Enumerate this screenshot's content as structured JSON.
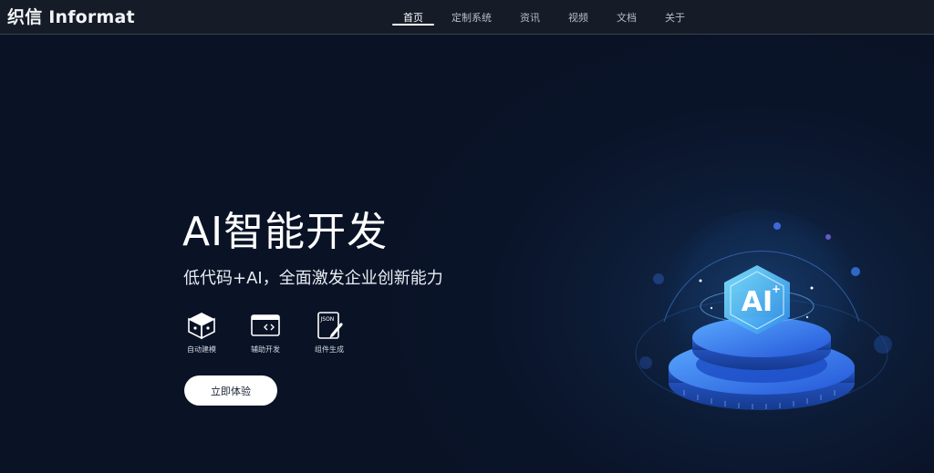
{
  "nav": {
    "logo": "织信 Informat",
    "items": [
      {
        "label": "首页",
        "active": true
      },
      {
        "label": "定制系统",
        "active": false
      },
      {
        "label": "资讯",
        "active": false
      },
      {
        "label": "视频",
        "active": false
      },
      {
        "label": "文档",
        "active": false
      },
      {
        "label": "关于",
        "active": false
      }
    ]
  },
  "hero": {
    "title": "AI智能开发",
    "subtitle": "低代码+AI，全面激发企业创新能力",
    "features": [
      {
        "label": "自动建模",
        "icon": "cube-icon"
      },
      {
        "label": "辅助开发",
        "icon": "code-window-icon"
      },
      {
        "label": "组件生成",
        "icon": "json-document-icon"
      }
    ],
    "cta_label": "立即体验",
    "illustration": {
      "badge_text": "AI",
      "accent": "#3a7bff",
      "glow": "#4fb3ff"
    }
  }
}
